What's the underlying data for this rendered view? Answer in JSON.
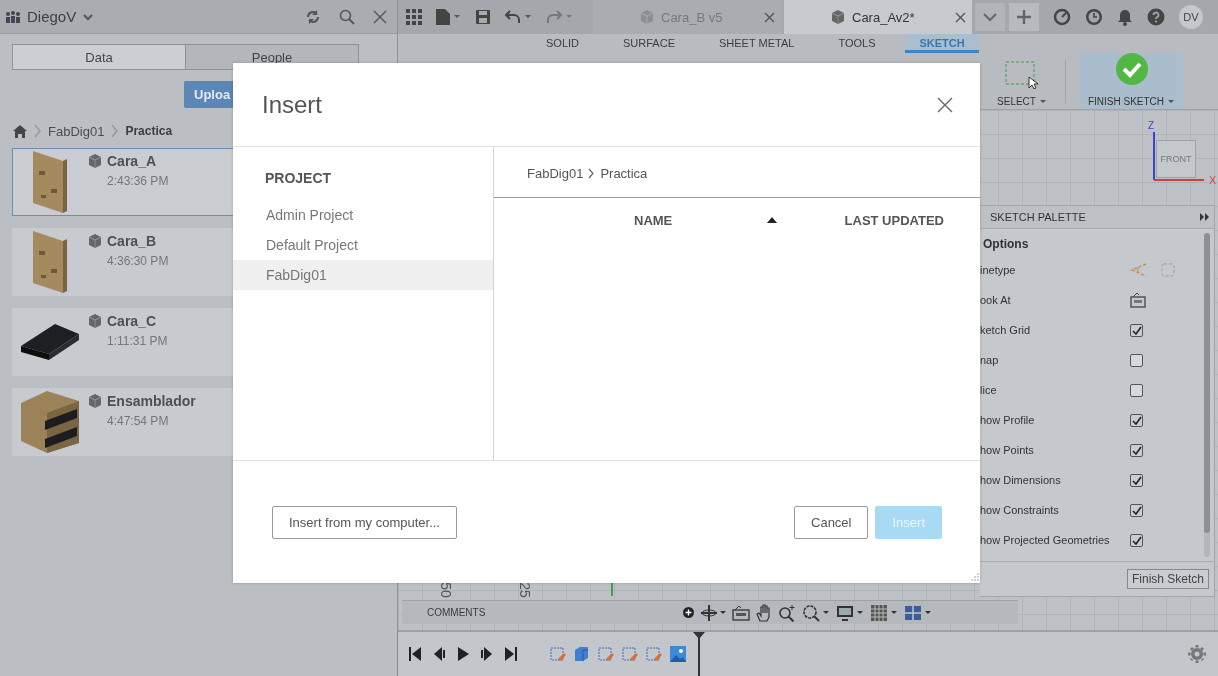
{
  "data_panel": {
    "user": "DiegoV",
    "tabs": [
      {
        "label": "Data",
        "selected": true
      },
      {
        "label": "People",
        "selected": false
      }
    ],
    "upload_button": "Uploa",
    "breadcrumb": [
      "FabDig01",
      "Practica"
    ],
    "files": [
      {
        "name": "Cara_A",
        "time": "2:43:36 PM",
        "selected": true,
        "kind": "wood"
      },
      {
        "name": "Cara_B",
        "time": "4:36:30 PM",
        "selected": false,
        "kind": "wood"
      },
      {
        "name": "Cara_C",
        "time": "1:11:31 PM",
        "selected": false,
        "kind": "black"
      },
      {
        "name": "Ensamblador",
        "time": "4:47:54 PM",
        "selected": false,
        "kind": "box"
      }
    ]
  },
  "toolbar": {
    "doc_tabs": [
      {
        "label": "Cara_B v5",
        "selected": false
      },
      {
        "label": "Cara_Av2*",
        "selected": true
      }
    ],
    "user_initials": "DV"
  },
  "ribbon": {
    "tabs": [
      {
        "label": "SOLID",
        "selected": false
      },
      {
        "label": "SURFACE",
        "selected": false
      },
      {
        "label": "SHEET METAL",
        "selected": false
      },
      {
        "label": "TOOLS",
        "selected": false
      },
      {
        "label": "SKETCH",
        "selected": true
      }
    ],
    "select_label": "SELECT",
    "finish_label": "FINISH SKETCH"
  },
  "viewcube": {
    "face": "FRONT",
    "z_label": "Z",
    "x_label": "X"
  },
  "ruler_labels": [
    "50",
    "25"
  ],
  "sketch_palette": {
    "title": "SKETCH PALETTE",
    "section": "Options",
    "rows": [
      {
        "label": "inetype",
        "kind": "linetype"
      },
      {
        "label": "ook At",
        "kind": "lookat"
      },
      {
        "label": "ketch Grid",
        "kind": "check",
        "checked": true
      },
      {
        "label": "nap",
        "kind": "check",
        "checked": false
      },
      {
        "label": "lice",
        "kind": "check",
        "checked": false
      },
      {
        "label": "how Profile",
        "kind": "check",
        "checked": true
      },
      {
        "label": "how Points",
        "kind": "check",
        "checked": true
      },
      {
        "label": "how Dimensions",
        "kind": "check",
        "checked": true
      },
      {
        "label": "how Constraints",
        "kind": "check",
        "checked": true
      },
      {
        "label": "how Projected Geometries",
        "kind": "check",
        "checked": true
      }
    ],
    "finish_button": "Finish Sketch"
  },
  "comments_label": "COMMENTS",
  "dialog": {
    "title": "Insert",
    "project_heading": "PROJECT",
    "projects": [
      {
        "label": "Admin Project",
        "selected": false
      },
      {
        "label": "Default Project",
        "selected": false
      },
      {
        "label": "FabDig01",
        "selected": true
      }
    ],
    "breadcrumb": [
      "FabDig01",
      "Practica"
    ],
    "columns": [
      {
        "label": "NAME",
        "sorted": true
      },
      {
        "label": "LAST UPDATED",
        "sorted": false
      }
    ],
    "buttons": [
      {
        "label": "Insert from my computer...",
        "kind": "secondary"
      },
      {
        "label": "Cancel",
        "kind": "secondary"
      },
      {
        "label": "Insert",
        "kind": "primary",
        "disabled": true
      }
    ]
  }
}
